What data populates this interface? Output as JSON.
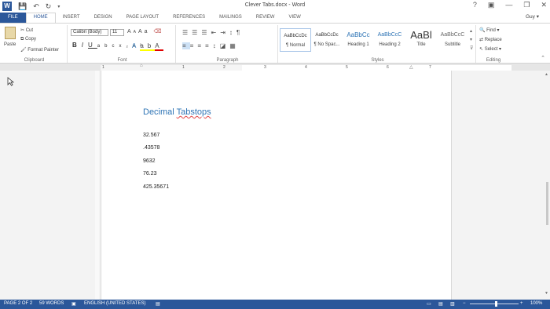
{
  "titlebar": {
    "title": "Clever Tabs.docx - Word",
    "word_icon": "W",
    "help": "?",
    "minimize": "—",
    "restore": "❐",
    "close": "✕"
  },
  "tabs": [
    {
      "label": "FILE"
    },
    {
      "label": "HOME"
    },
    {
      "label": "INSERT"
    },
    {
      "label": "DESIGN"
    },
    {
      "label": "PAGE LAYOUT"
    },
    {
      "label": "REFERENCES"
    },
    {
      "label": "MAILINGS"
    },
    {
      "label": "REVIEW"
    },
    {
      "label": "VIEW"
    }
  ],
  "user": "Guy",
  "clipboard": {
    "paste": "Paste",
    "cut": "Cut",
    "copy": "Copy",
    "format_painter": "Format Painter",
    "label": "Clipboard"
  },
  "font": {
    "name": "Calibri (Body)",
    "size": "11",
    "label": "Font"
  },
  "paragraph": {
    "label": "Paragraph"
  },
  "styles": {
    "label": "Styles",
    "items": [
      {
        "sample": "AaBbCcDc",
        "name": "¶ Normal"
      },
      {
        "sample": "AaBbCcDc",
        "name": "¶ No Spac..."
      },
      {
        "sample": "AaBbCc",
        "name": "Heading 1"
      },
      {
        "sample": "AaBbCcC",
        "name": "Heading 2"
      },
      {
        "sample": "AaBl",
        "name": "Title"
      },
      {
        "sample": "AaBbCcC",
        "name": "Subtitle"
      }
    ]
  },
  "editing": {
    "find": "Find",
    "replace": "Replace",
    "select": "Select",
    "label": "Editing"
  },
  "ruler": {
    "numbers": [
      "1",
      "1",
      "2",
      "3",
      "4",
      "5",
      "6",
      "7"
    ]
  },
  "document": {
    "heading_word1": "Decimal",
    "heading_word2": "Tabstops",
    "numbers": [
      "32.567",
      ".43578",
      "9632",
      "76.23",
      "425.35671"
    ]
  },
  "status": {
    "page": "PAGE 2 OF 2",
    "words": "59 WORDS",
    "language": "ENGLISH (UNITED STATES)",
    "zoom": "100%"
  },
  "colors": {
    "accent": "#2b579a",
    "heading": "#2e74b5"
  }
}
